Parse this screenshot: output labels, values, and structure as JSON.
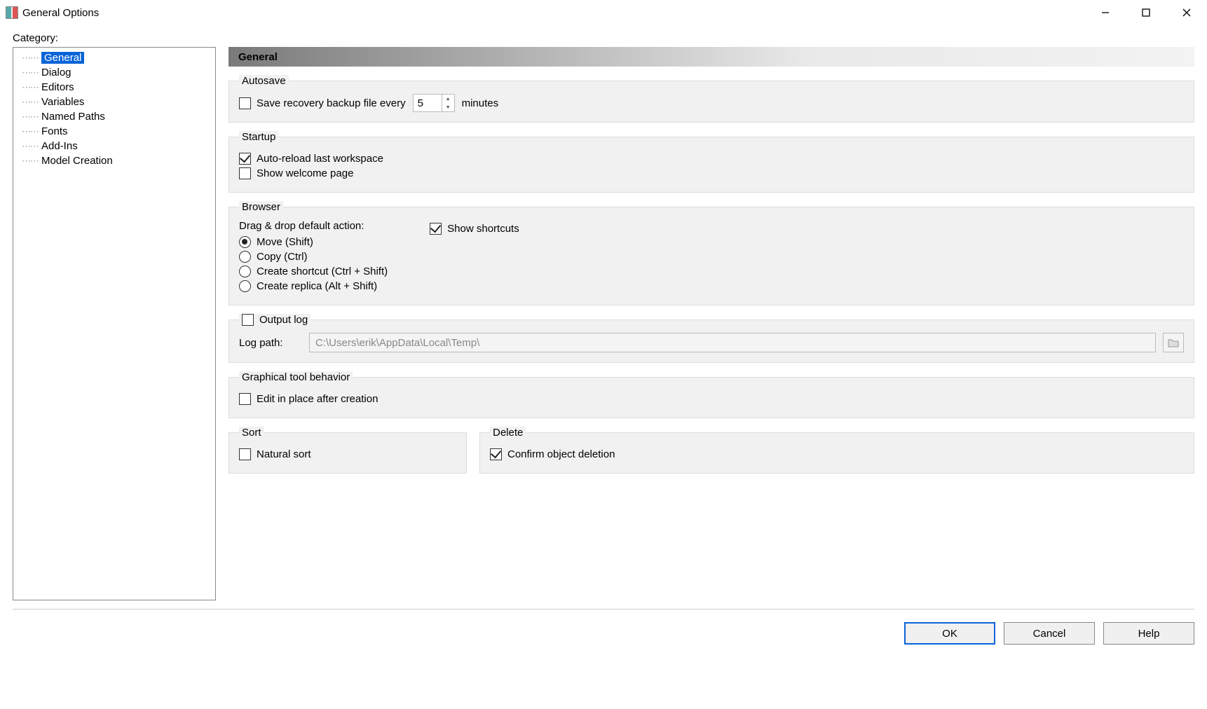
{
  "window": {
    "title": "General Options"
  },
  "category_label": "Category:",
  "tree": {
    "items": [
      {
        "label": "General",
        "selected": true
      },
      {
        "label": "Dialog"
      },
      {
        "label": "Editors"
      },
      {
        "label": "Variables"
      },
      {
        "label": "Named Paths"
      },
      {
        "label": "Fonts"
      },
      {
        "label": "Add-Ins"
      },
      {
        "label": "Model Creation"
      }
    ]
  },
  "section_title": "General",
  "autosave": {
    "legend": "Autosave",
    "checkbox": "Save recovery backup file every",
    "value": "5",
    "unit": "minutes",
    "checked": false
  },
  "startup": {
    "legend": "Startup",
    "auto_reload": {
      "label": "Auto-reload last workspace",
      "checked": true
    },
    "show_welcome": {
      "label": "Show welcome page",
      "checked": false
    }
  },
  "browser": {
    "legend": "Browser",
    "drag_label": "Drag & drop default action:",
    "options": [
      {
        "label": "Move (Shift)",
        "checked": true
      },
      {
        "label": "Copy (Ctrl)",
        "checked": false
      },
      {
        "label": "Create shortcut (Ctrl + Shift)",
        "checked": false
      },
      {
        "label": "Create replica (Alt + Shift)",
        "checked": false
      }
    ],
    "show_shortcuts": {
      "label": "Show shortcuts",
      "checked": true
    }
  },
  "outputlog": {
    "checkbox": "Output log",
    "checked": false,
    "path_label": "Log path:",
    "path_value": "C:\\Users\\erik\\AppData\\Local\\Temp\\"
  },
  "graphical": {
    "legend": "Graphical tool behavior",
    "edit_in_place": {
      "label": "Edit in place after creation",
      "checked": false
    }
  },
  "sort": {
    "legend": "Sort",
    "natural": {
      "label": "Natural sort",
      "checked": false
    }
  },
  "delete": {
    "legend": "Delete",
    "confirm": {
      "label": "Confirm object deletion",
      "checked": true
    }
  },
  "buttons": {
    "ok": "OK",
    "cancel": "Cancel",
    "help": "Help"
  }
}
